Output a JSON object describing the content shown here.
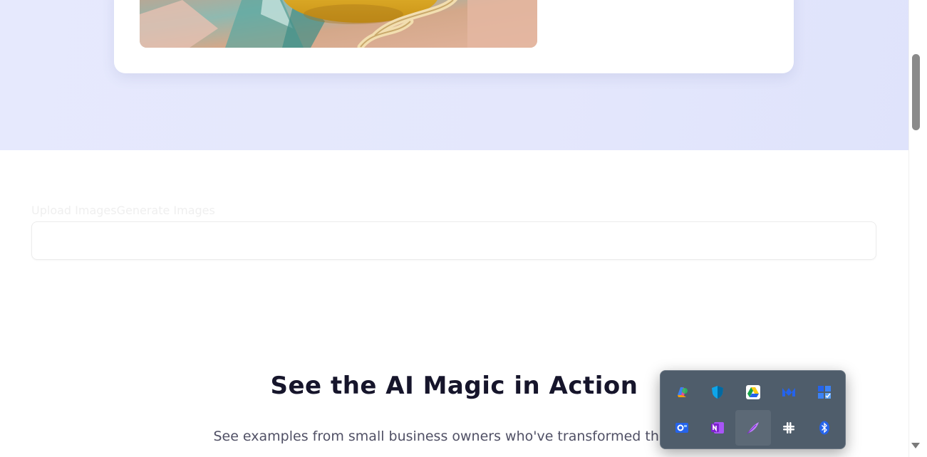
{
  "tabs": {
    "upload_label": "Upload Images",
    "generate_label": "Generate Images"
  },
  "section": {
    "title": "See the AI Magic in Action",
    "description_line1": "See examples from small business owners who've transformed their pr"
  },
  "tray": {
    "items": [
      {
        "icon": "copilot-icon"
      },
      {
        "icon": "defender-shield-icon"
      },
      {
        "icon": "google-drive-icon"
      },
      {
        "icon": "meet-icon"
      },
      {
        "icon": "todo-grid-icon"
      },
      {
        "icon": "outlook-icon"
      },
      {
        "icon": "onenote-icon"
      },
      {
        "icon": "feather-pen-icon",
        "active": true
      },
      {
        "icon": "slack-icon"
      },
      {
        "icon": "bluetooth-icon"
      }
    ]
  },
  "colors": {
    "hero_bg": "#e4e7fc",
    "title": "#16152b",
    "tray_bg": "#4f5d6b"
  }
}
